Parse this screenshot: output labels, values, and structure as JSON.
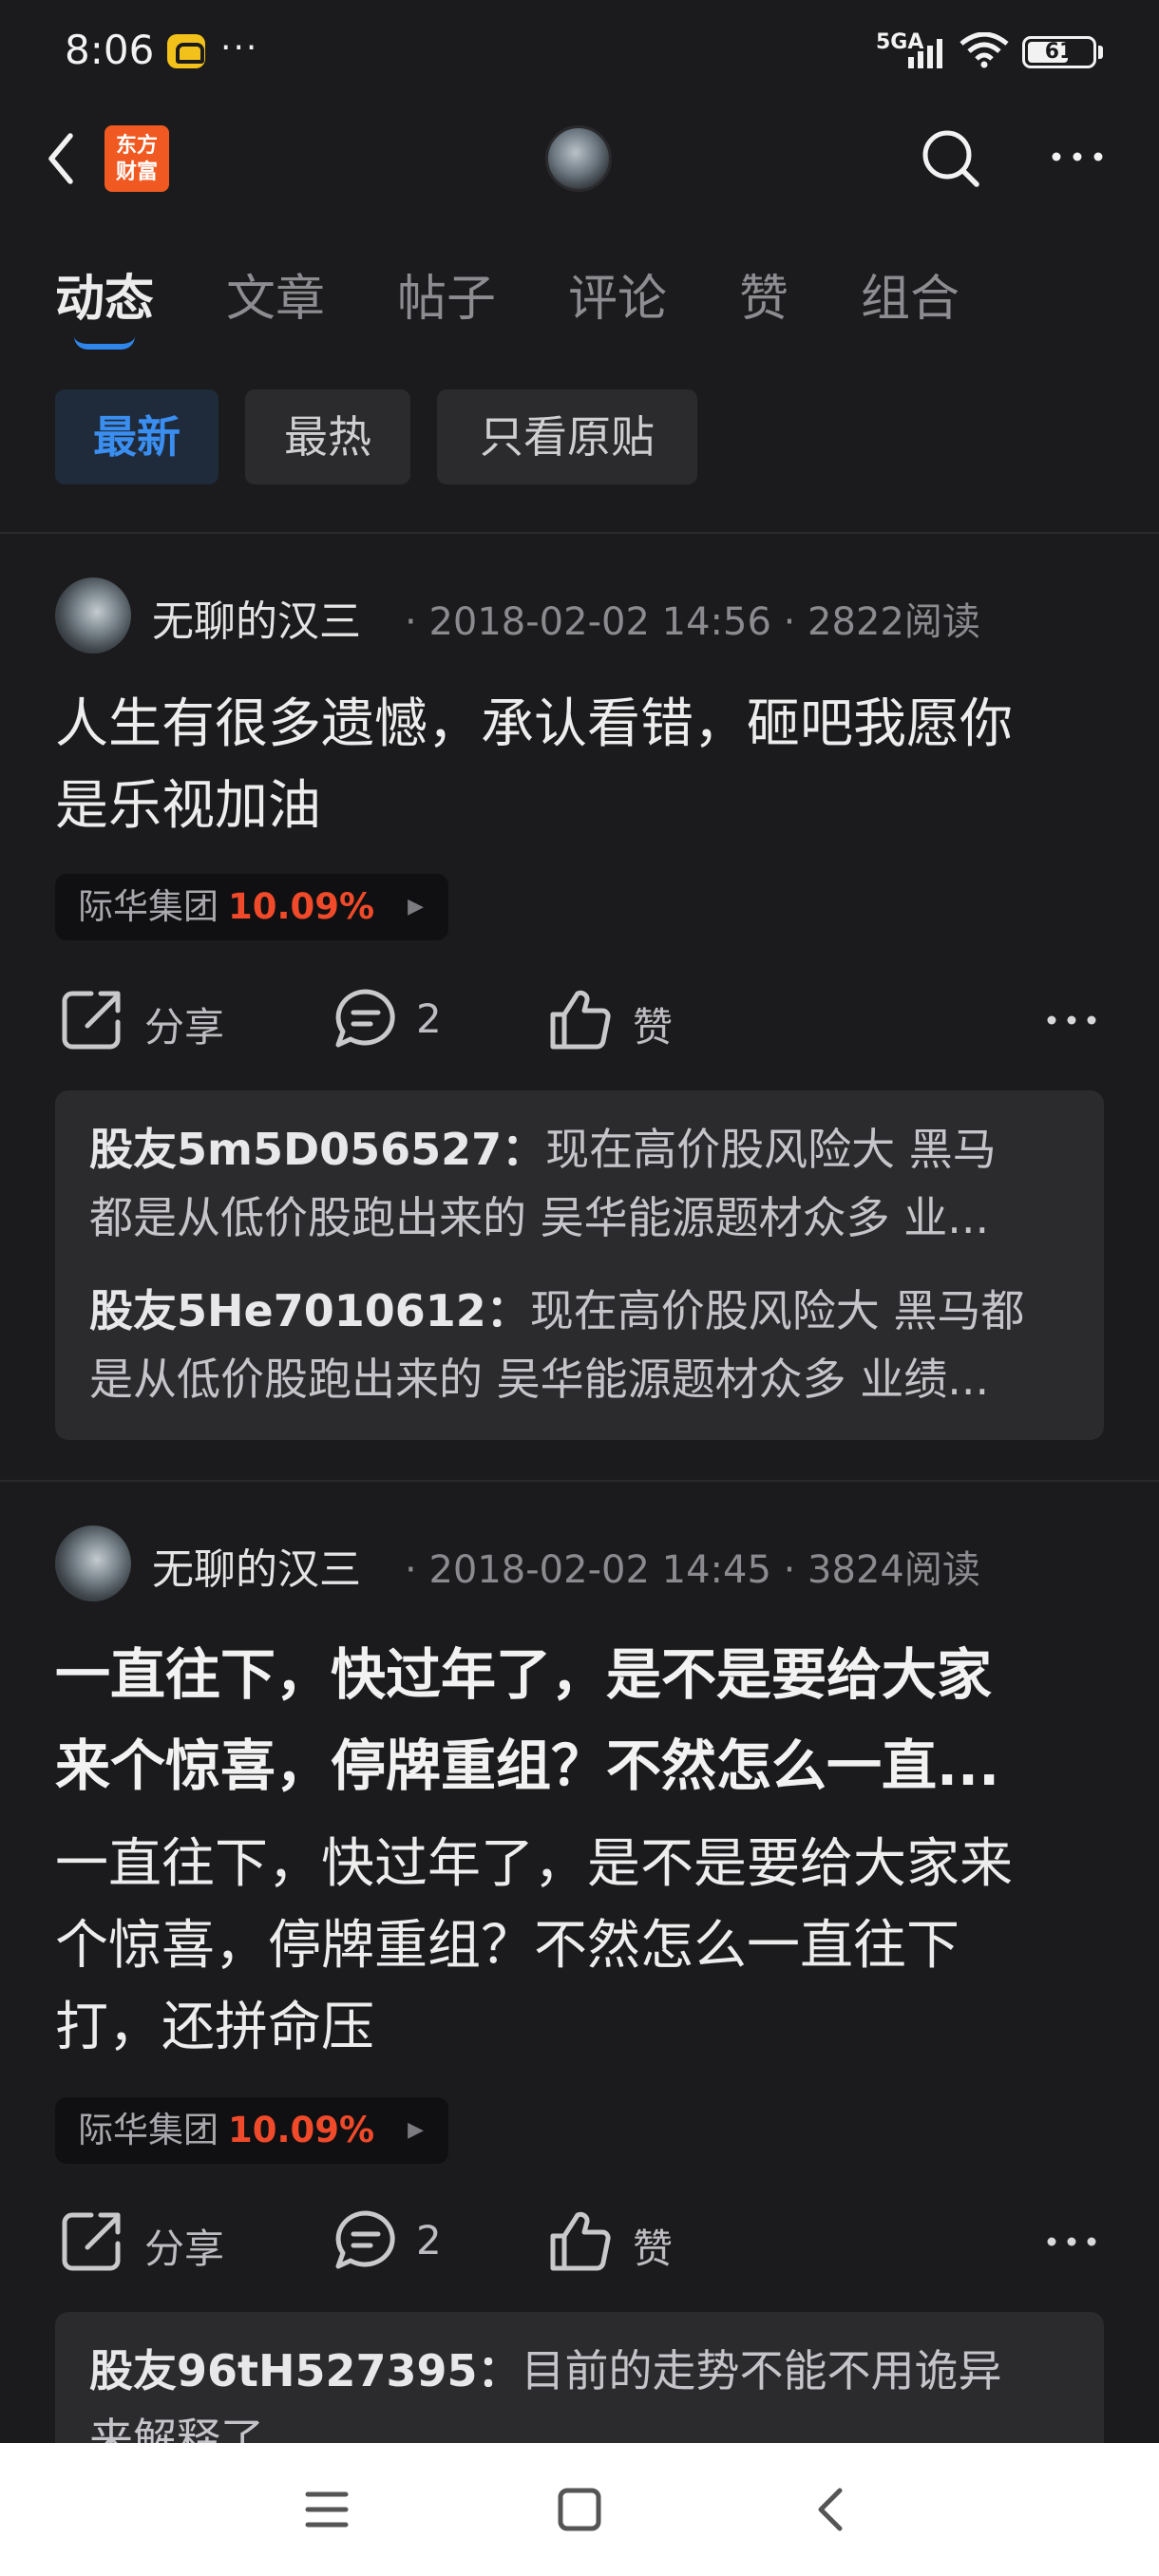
{
  "status_bar": {
    "time": "8:06",
    "network": "5GA",
    "battery": "61",
    "battery_level": 0.61
  },
  "header": {
    "brand_line1": "东方",
    "brand_line2": "财富"
  },
  "tabs": [
    {
      "label": "动态",
      "active": true
    },
    {
      "label": "文章",
      "active": false
    },
    {
      "label": "帖子",
      "active": false
    },
    {
      "label": "评论",
      "active": false
    },
    {
      "label": "赞",
      "active": false
    },
    {
      "label": "组合",
      "active": false
    }
  ],
  "filters": [
    {
      "label": "最新",
      "active": true
    },
    {
      "label": "最热",
      "active": false
    },
    {
      "label": "只看原贴",
      "active": false
    }
  ],
  "posts": [
    {
      "author": "无聊的汉三",
      "date": "2018-02-02 14:56",
      "reads": "2822阅读",
      "text_line1": "人生有很多遗憾，承认看错，砸吧我愿你",
      "text_line2": "是乐视加油",
      "stock": {
        "name": "际华集团",
        "change": "10.09%"
      },
      "actions": {
        "share": "分享",
        "comments": "2",
        "like": "赞"
      },
      "comments": [
        {
          "user": "股友5m5D056527：",
          "text1": "现在高价股风险大 黑马",
          "text2": "都是从低价股跑出来的 吴华能源题材众多 业..."
        },
        {
          "user": "股友5He7010612：",
          "text1": "现在高价股风险大 黑马都",
          "text2": "是从低价股跑出来的 吴华能源题材众多 业绩..."
        }
      ]
    },
    {
      "author": "无聊的汉三",
      "date": "2018-02-02 14:45",
      "reads": "3824阅读",
      "title_line1": "一直往下，快过年了，是不是要给大家",
      "title_line2": "来个惊喜，停牌重组？不然怎么一直...",
      "text_line1": "一直往下，快过年了，是不是要给大家来",
      "text_line2": "个惊喜，停牌重组？不然怎么一直往下",
      "text_line3": "打，还拼命压",
      "stock": {
        "name": "际华集团",
        "change": "10.09%"
      },
      "actions": {
        "share": "分享",
        "comments": "2",
        "like": "赞"
      },
      "comments": [
        {
          "user": "股友96tH527395：",
          "text1": "目前的走势不能不用诡异",
          "text2": "来解释了"
        }
      ]
    }
  ]
}
